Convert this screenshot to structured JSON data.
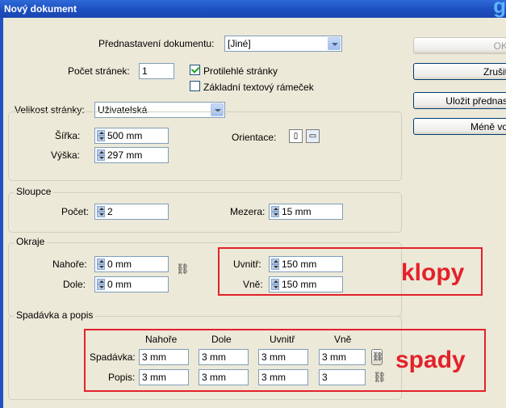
{
  "title": "Nový dokument",
  "peek_text": "g",
  "preset": {
    "label": "Přednastavení dokumentu:",
    "value": "[Jiné]"
  },
  "pages": {
    "label": "Počet stránek:",
    "value": "1"
  },
  "facing": {
    "label": "Protilehlé stránky",
    "checked": true
  },
  "text_frame": {
    "label": "Základní textový rámeček",
    "checked": false
  },
  "buttons": {
    "ok": "OK",
    "cancel": "Zrušit",
    "save_preset": "Uložit přednas",
    "fewer": "Méně vo"
  },
  "page_size": {
    "label": "Velikost stránky:",
    "value": "Uživatelská",
    "width_label": "Šířka:",
    "width": "500 mm",
    "height_label": "Výška:",
    "height": "297 mm",
    "orientation_label": "Orientace:"
  },
  "columns": {
    "title": "Sloupce",
    "count_label": "Počet:",
    "count": "2",
    "gap_label": "Mezera:",
    "gap": "15 mm"
  },
  "margins": {
    "title": "Okraje",
    "top_label": "Nahoře:",
    "top": "0 mm",
    "bottom_label": "Dole:",
    "bottom": "0 mm",
    "inside_label": "Uvnitř:",
    "inside": "150 mm",
    "outside_label": "Vně:",
    "outside": "150 mm"
  },
  "bleed": {
    "title": "Spadávka a popis",
    "headers": [
      "Nahoře",
      "Dole",
      "Uvnitř",
      "Vně"
    ],
    "bleed_label": "Spadávka:",
    "bleed_values": [
      "3 mm",
      "3 mm",
      "3 mm",
      "3 mm"
    ],
    "slug_label": "Popis:",
    "slug_values": [
      "3 mm",
      "3 mm",
      "3 mm",
      "3"
    ]
  },
  "annotations": {
    "klopy": "klopy",
    "spady": "spady",
    "color": "#e3212a"
  }
}
